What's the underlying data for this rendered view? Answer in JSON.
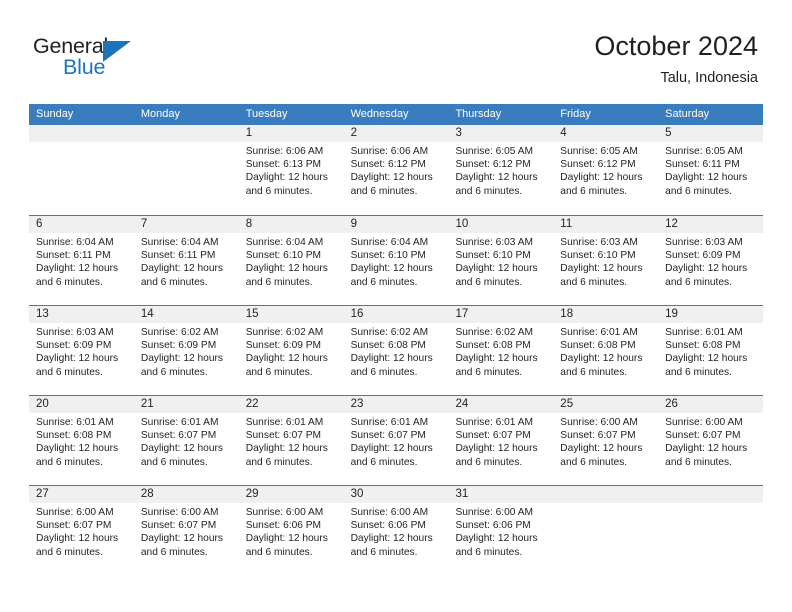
{
  "brand": {
    "name_part1": "General",
    "name_part2": "Blue",
    "accent_color": "#1b75bb"
  },
  "header": {
    "title": "October 2024",
    "location": "Talu, Indonesia"
  },
  "calendar": {
    "header_bg": "#3a7dbf",
    "weekdays": [
      "Sunday",
      "Monday",
      "Tuesday",
      "Wednesday",
      "Thursday",
      "Friday",
      "Saturday"
    ],
    "labels": {
      "sunrise": "Sunrise:",
      "sunset": "Sunset:",
      "daylight": "Daylight:"
    },
    "weeks": [
      [
        {
          "day": "",
          "empty": true
        },
        {
          "day": "",
          "empty": true
        },
        {
          "day": "1",
          "sunrise": "Sunrise: 6:06 AM",
          "sunset": "Sunset: 6:13 PM",
          "daylight_line1": "Daylight: 12 hours",
          "daylight_line2": "and 6 minutes."
        },
        {
          "day": "2",
          "sunrise": "Sunrise: 6:06 AM",
          "sunset": "Sunset: 6:12 PM",
          "daylight_line1": "Daylight: 12 hours",
          "daylight_line2": "and 6 minutes."
        },
        {
          "day": "3",
          "sunrise": "Sunrise: 6:05 AM",
          "sunset": "Sunset: 6:12 PM",
          "daylight_line1": "Daylight: 12 hours",
          "daylight_line2": "and 6 minutes."
        },
        {
          "day": "4",
          "sunrise": "Sunrise: 6:05 AM",
          "sunset": "Sunset: 6:12 PM",
          "daylight_line1": "Daylight: 12 hours",
          "daylight_line2": "and 6 minutes."
        },
        {
          "day": "5",
          "sunrise": "Sunrise: 6:05 AM",
          "sunset": "Sunset: 6:11 PM",
          "daylight_line1": "Daylight: 12 hours",
          "daylight_line2": "and 6 minutes."
        }
      ],
      [
        {
          "day": "6",
          "sunrise": "Sunrise: 6:04 AM",
          "sunset": "Sunset: 6:11 PM",
          "daylight_line1": "Daylight: 12 hours",
          "daylight_line2": "and 6 minutes."
        },
        {
          "day": "7",
          "sunrise": "Sunrise: 6:04 AM",
          "sunset": "Sunset: 6:11 PM",
          "daylight_line1": "Daylight: 12 hours",
          "daylight_line2": "and 6 minutes."
        },
        {
          "day": "8",
          "sunrise": "Sunrise: 6:04 AM",
          "sunset": "Sunset: 6:10 PM",
          "daylight_line1": "Daylight: 12 hours",
          "daylight_line2": "and 6 minutes."
        },
        {
          "day": "9",
          "sunrise": "Sunrise: 6:04 AM",
          "sunset": "Sunset: 6:10 PM",
          "daylight_line1": "Daylight: 12 hours",
          "daylight_line2": "and 6 minutes."
        },
        {
          "day": "10",
          "sunrise": "Sunrise: 6:03 AM",
          "sunset": "Sunset: 6:10 PM",
          "daylight_line1": "Daylight: 12 hours",
          "daylight_line2": "and 6 minutes."
        },
        {
          "day": "11",
          "sunrise": "Sunrise: 6:03 AM",
          "sunset": "Sunset: 6:10 PM",
          "daylight_line1": "Daylight: 12 hours",
          "daylight_line2": "and 6 minutes."
        },
        {
          "day": "12",
          "sunrise": "Sunrise: 6:03 AM",
          "sunset": "Sunset: 6:09 PM",
          "daylight_line1": "Daylight: 12 hours",
          "daylight_line2": "and 6 minutes."
        }
      ],
      [
        {
          "day": "13",
          "sunrise": "Sunrise: 6:03 AM",
          "sunset": "Sunset: 6:09 PM",
          "daylight_line1": "Daylight: 12 hours",
          "daylight_line2": "and 6 minutes."
        },
        {
          "day": "14",
          "sunrise": "Sunrise: 6:02 AM",
          "sunset": "Sunset: 6:09 PM",
          "daylight_line1": "Daylight: 12 hours",
          "daylight_line2": "and 6 minutes."
        },
        {
          "day": "15",
          "sunrise": "Sunrise: 6:02 AM",
          "sunset": "Sunset: 6:09 PM",
          "daylight_line1": "Daylight: 12 hours",
          "daylight_line2": "and 6 minutes."
        },
        {
          "day": "16",
          "sunrise": "Sunrise: 6:02 AM",
          "sunset": "Sunset: 6:08 PM",
          "daylight_line1": "Daylight: 12 hours",
          "daylight_line2": "and 6 minutes."
        },
        {
          "day": "17",
          "sunrise": "Sunrise: 6:02 AM",
          "sunset": "Sunset: 6:08 PM",
          "daylight_line1": "Daylight: 12 hours",
          "daylight_line2": "and 6 minutes."
        },
        {
          "day": "18",
          "sunrise": "Sunrise: 6:01 AM",
          "sunset": "Sunset: 6:08 PM",
          "daylight_line1": "Daylight: 12 hours",
          "daylight_line2": "and 6 minutes."
        },
        {
          "day": "19",
          "sunrise": "Sunrise: 6:01 AM",
          "sunset": "Sunset: 6:08 PM",
          "daylight_line1": "Daylight: 12 hours",
          "daylight_line2": "and 6 minutes."
        }
      ],
      [
        {
          "day": "20",
          "sunrise": "Sunrise: 6:01 AM",
          "sunset": "Sunset: 6:08 PM",
          "daylight_line1": "Daylight: 12 hours",
          "daylight_line2": "and 6 minutes."
        },
        {
          "day": "21",
          "sunrise": "Sunrise: 6:01 AM",
          "sunset": "Sunset: 6:07 PM",
          "daylight_line1": "Daylight: 12 hours",
          "daylight_line2": "and 6 minutes."
        },
        {
          "day": "22",
          "sunrise": "Sunrise: 6:01 AM",
          "sunset": "Sunset: 6:07 PM",
          "daylight_line1": "Daylight: 12 hours",
          "daylight_line2": "and 6 minutes."
        },
        {
          "day": "23",
          "sunrise": "Sunrise: 6:01 AM",
          "sunset": "Sunset: 6:07 PM",
          "daylight_line1": "Daylight: 12 hours",
          "daylight_line2": "and 6 minutes."
        },
        {
          "day": "24",
          "sunrise": "Sunrise: 6:01 AM",
          "sunset": "Sunset: 6:07 PM",
          "daylight_line1": "Daylight: 12 hours",
          "daylight_line2": "and 6 minutes."
        },
        {
          "day": "25",
          "sunrise": "Sunrise: 6:00 AM",
          "sunset": "Sunset: 6:07 PM",
          "daylight_line1": "Daylight: 12 hours",
          "daylight_line2": "and 6 minutes."
        },
        {
          "day": "26",
          "sunrise": "Sunrise: 6:00 AM",
          "sunset": "Sunset: 6:07 PM",
          "daylight_line1": "Daylight: 12 hours",
          "daylight_line2": "and 6 minutes."
        }
      ],
      [
        {
          "day": "27",
          "sunrise": "Sunrise: 6:00 AM",
          "sunset": "Sunset: 6:07 PM",
          "daylight_line1": "Daylight: 12 hours",
          "daylight_line2": "and 6 minutes."
        },
        {
          "day": "28",
          "sunrise": "Sunrise: 6:00 AM",
          "sunset": "Sunset: 6:07 PM",
          "daylight_line1": "Daylight: 12 hours",
          "daylight_line2": "and 6 minutes."
        },
        {
          "day": "29",
          "sunrise": "Sunrise: 6:00 AM",
          "sunset": "Sunset: 6:06 PM",
          "daylight_line1": "Daylight: 12 hours",
          "daylight_line2": "and 6 minutes."
        },
        {
          "day": "30",
          "sunrise": "Sunrise: 6:00 AM",
          "sunset": "Sunset: 6:06 PM",
          "daylight_line1": "Daylight: 12 hours",
          "daylight_line2": "and 6 minutes."
        },
        {
          "day": "31",
          "sunrise": "Sunrise: 6:00 AM",
          "sunset": "Sunset: 6:06 PM",
          "daylight_line1": "Daylight: 12 hours",
          "daylight_line2": "and 6 minutes."
        },
        {
          "day": "",
          "empty": true
        },
        {
          "day": "",
          "empty": true
        }
      ]
    ]
  }
}
